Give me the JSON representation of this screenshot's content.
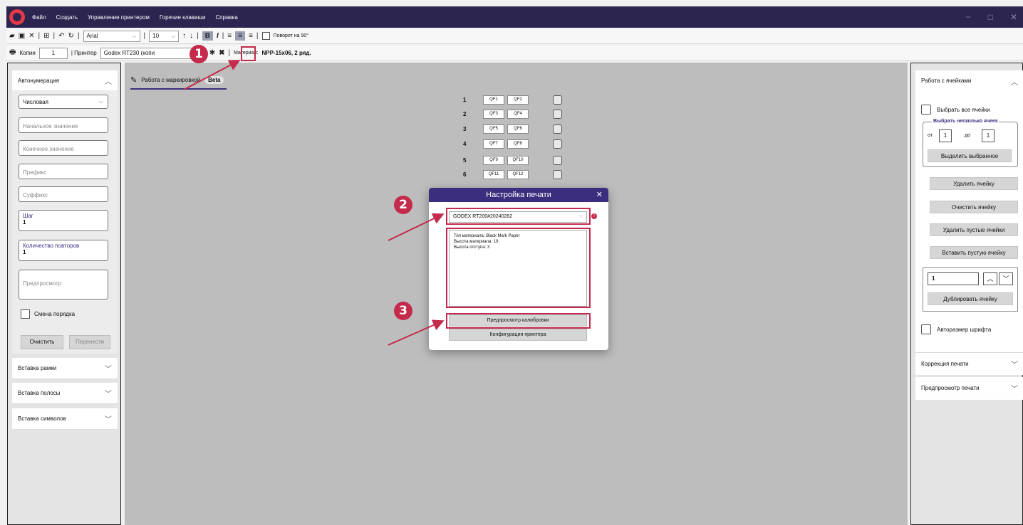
{
  "menu": {
    "items": [
      "Файл",
      "Создать",
      "Управление принтером",
      "Горячие клавиши",
      "Справка"
    ]
  },
  "toolbar1": {
    "font": "Arial",
    "size": "10",
    "rotate_label": "Поворот на 90°"
  },
  "toolbar2": {
    "copies_label": "Копии",
    "copies_value": "1",
    "printer_label": "| Принтер",
    "printer_value": "Godex RT230 (копи",
    "material_label": "Материал:",
    "material_value": "NPP-15x06, 2 ряд."
  },
  "left": {
    "autonum_title": "Автонумерация",
    "type_value": "Числовая",
    "start_placeholder": "Начальное значение",
    "end_placeholder": "Конечное значение",
    "prefix_placeholder": "Префикс",
    "suffix_placeholder": "Суффикс",
    "step_label": "Шаг",
    "step_value": "1",
    "repeat_label": "Количество повторов",
    "repeat_value": "1",
    "preview_label": "Предпросмотр",
    "order_label": "Смена порядка",
    "clear_btn": "Очистить",
    "transfer_btn": "Перенести",
    "frame_title": "Вставка рамки",
    "stripe_title": "Вставка полосы",
    "symbol_title": "Вставка символов"
  },
  "tab": {
    "label": "Работа с маркировкой",
    "beta": "Beta"
  },
  "rows": [
    {
      "num": "1",
      "c1": "QF1",
      "c2": "QF2"
    },
    {
      "num": "2",
      "c1": "QF3",
      "c2": "QF4"
    },
    {
      "num": "3",
      "c1": "QF5",
      "c2": "QF6"
    },
    {
      "num": "4",
      "c1": "QF7",
      "c2": "QF8"
    },
    {
      "num": "5",
      "c1": "QF9",
      "c2": "QF10"
    },
    {
      "num": "6",
      "c1": "QF11",
      "c2": "QF12"
    }
  ],
  "modal": {
    "title": "Настройка печати",
    "printer": "GODEX RT200#20240262",
    "info_line1": "Тип материала: Black Mark Paper",
    "info_line2": "Высота материала: 19",
    "info_line3": "Высота отступа: 3",
    "calib_btn": "Предпросмотр калибровки",
    "config_btn": "Конфигурация принтера"
  },
  "badges": {
    "b1": "1",
    "b2": "2",
    "b3": "3"
  },
  "right": {
    "cells_title": "Работа с ячейками",
    "select_all": "Выбрать все ячейки",
    "select_multi": "Выбрать несколько ячеек",
    "from_label": "от",
    "from_value": "1",
    "to_label": "до",
    "to_value": "1",
    "highlight_btn": "Выделить выбранное",
    "delete_btn": "Удалить ячейку",
    "clear_btn": "Очистить ячейку",
    "delete_empty_btn": "Удалить пустые ячейки",
    "insert_empty_btn": "Вставить пустую ячейку",
    "dup_value": "1",
    "dup_btn": "Дублировать ячейку",
    "autosize_label": "Авторазмер шрифта",
    "correction_title": "Коррекция печати",
    "preview_title": "Предпросмотр печати"
  },
  "colors": {
    "accent": "#3b2e7e",
    "highlight": "#c42a4b",
    "titlebar": "#2b2550"
  }
}
